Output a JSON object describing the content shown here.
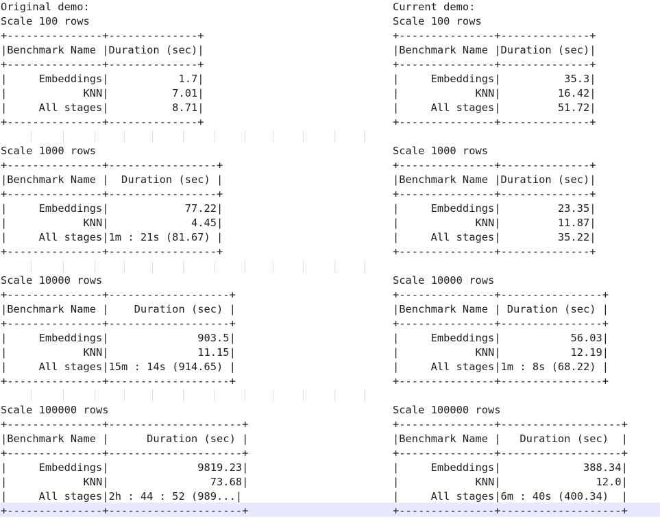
{
  "editor": {
    "left_lines": [
      "Original demo:",
      "Scale 100 rows",
      "+---------------+--------------+",
      "|Benchmark Name |Duration (sec)|",
      "+---------------+--------------+",
      "|     Embeddings|           1.7|",
      "|            KNN|          7.01|",
      "|     All stages|          8.71|",
      "+---------------+--------------+",
      "",
      "Scale 1000 rows",
      "+---------------+-----------------+",
      "|Benchmark Name |  Duration (sec) |",
      "+---------------+-----------------+",
      "|     Embeddings|            77.22|",
      "|            KNN|             4.45|",
      "|     All stages|1m : 21s (81.67) |",
      "+---------------+-----------------+",
      "",
      "Scale 10000 rows",
      "+---------------+-------------------+",
      "|Benchmark Name |    Duration (sec) |",
      "+---------------+-------------------+",
      "|     Embeddings|              903.5|",
      "|            KNN|              11.15|",
      "|     All stages|15m : 14s (914.65) |",
      "+---------------+-------------------+",
      "",
      "Scale 100000 rows",
      "+---------------+---------------------+",
      "|Benchmark Name |      Duration (sec) |",
      "+---------------+---------------------+",
      "|     Embeddings|              9819.23|",
      "|            KNN|                73.68|",
      "|     All stages|2h : 44 : 52 (989...|",
      "+---------------+---------------------+"
    ],
    "right_lines": [
      "Current demo:",
      "Scale 100 rows",
      "+---------------+--------------+",
      "|Benchmark Name |Duration (sec)|",
      "+---------------+--------------+",
      "|     Embeddings|          35.3|",
      "|            KNN|         16.42|",
      "|     All stages|         51.72|",
      "+---------------+--------------+",
      "",
      "Scale 1000 rows",
      "+---------------+--------------+",
      "|Benchmark Name |Duration (sec)|",
      "+---------------+--------------+",
      "|     Embeddings|         23.35|",
      "|            KNN|         11.87|",
      "|     All stages|         35.22|",
      "+---------------+--------------+",
      "",
      "Scale 10000 rows",
      "+---------------+----------------+",
      "|Benchmark Name | Duration (sec) |",
      "+---------------+----------------+",
      "|     Embeddings|           56.03|",
      "|            KNN|           12.19|",
      "|     All stages|1m : 8s (68.22) |",
      "+---------------+----------------+",
      "",
      "Scale 100000 rows",
      "+---------------+-------------------+",
      "|Benchmark Name |   Duration (sec)  |",
      "+---------------+-------------------+",
      "|     Embeddings|             388.34|",
      "|            KNN|               12.0|",
      "|     All stages|6m : 40s (400.34)  |",
      "+---------------+-------------------+"
    ]
  }
}
